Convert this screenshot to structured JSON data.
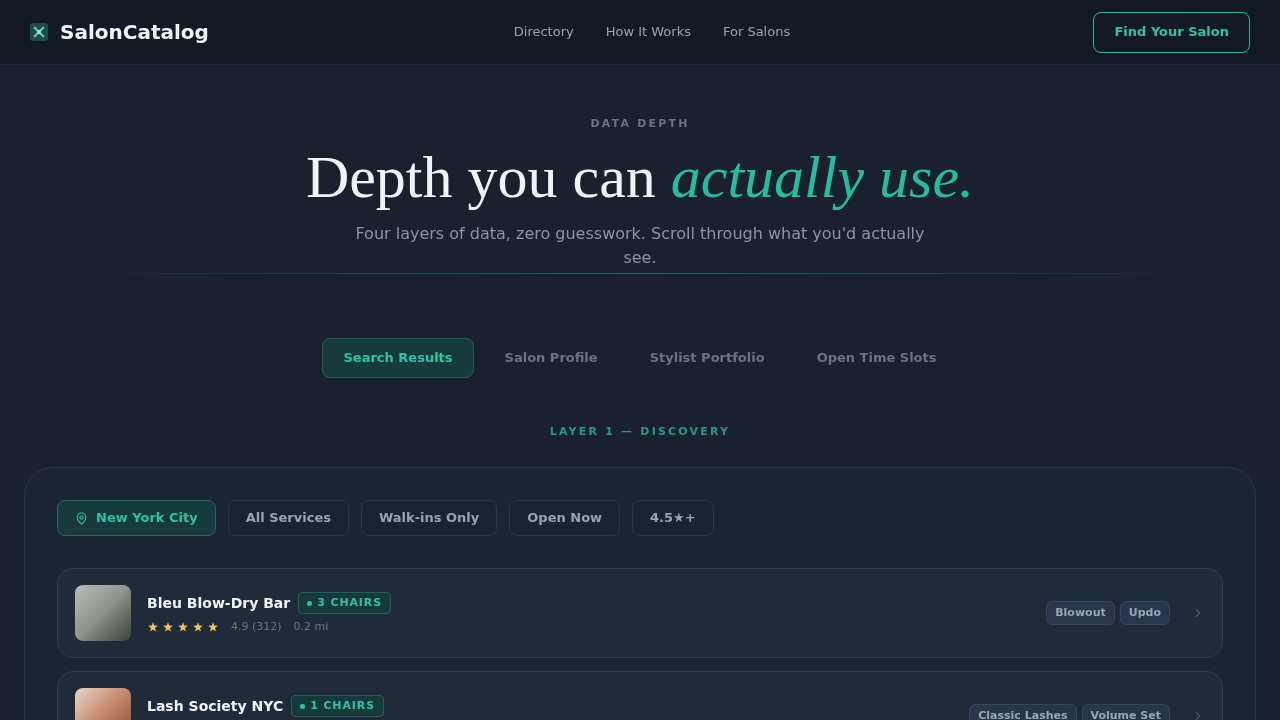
{
  "nav": {
    "brand": "SalonCatalog",
    "links": [
      "Directory",
      "How It Works",
      "For Salons"
    ],
    "cta": "Find Your Salon"
  },
  "hero": {
    "eyebrow": "DATA DEPTH",
    "headline": "Depth you can",
    "headline_accent": "actually use.",
    "subtitle": "Four layers of data, zero guesswork. Scroll through what you'd actually see."
  },
  "tabs": [
    {
      "label": "Search Results",
      "selected": true
    },
    {
      "label": "Salon Profile",
      "selected": false
    },
    {
      "label": "Stylist Portfolio",
      "selected": false
    },
    {
      "label": "Open Time Slots",
      "selected": false
    }
  ],
  "layer_label": "LAYER 1 — DISCOVERY",
  "filters": [
    {
      "label": "New York City",
      "kind": "location",
      "selected": true
    },
    {
      "label": "All Services",
      "kind": "plain",
      "selected": false
    },
    {
      "label": "Walk-ins Only",
      "kind": "plain",
      "selected": false
    },
    {
      "label": "Open Now",
      "kind": "plain",
      "selected": false
    },
    {
      "label": "4.5★+",
      "kind": "plain",
      "selected": false
    }
  ],
  "results": [
    {
      "name": "Bleu Blow-Dry Bar",
      "chairs": "3 CHAIRS",
      "stars": 5,
      "rating": "4.9 (312)",
      "distance": "0.2 mi",
      "tags": [
        "Blowout",
        "Updo"
      ]
    },
    {
      "name": "Lash Society NYC",
      "chairs": "1 CHAIRS",
      "tags": [
        "Classic Lashes",
        "Volume Set"
      ]
    }
  ]
}
